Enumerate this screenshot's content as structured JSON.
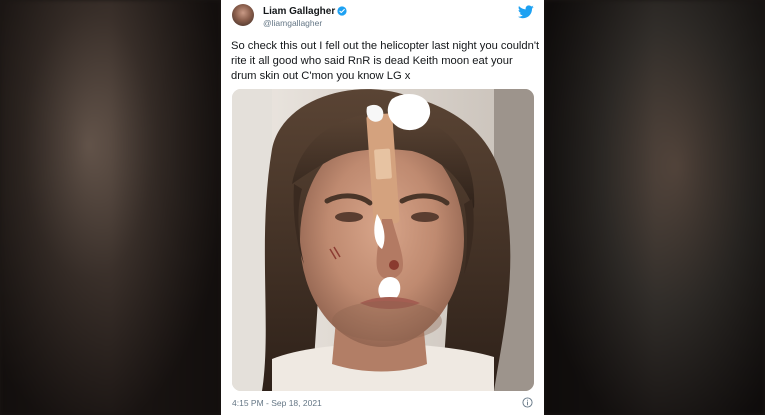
{
  "tweet": {
    "display_name": "Liam Gallagher",
    "handle": "@liamgallagher",
    "text": "So check this out I fell out the helicopter last night you couldn't rite it all good who said RnR is dead Keith moon eat your drum skin out C'mon you know LG x",
    "timestamp": "4:15 PM - Sep 18, 2021"
  },
  "icons": {
    "verified": "verified-badge-icon",
    "brand": "twitter-bird-icon",
    "info": "info-icon"
  },
  "colors": {
    "twitter_blue": "#1da1f2",
    "text": "#14171a",
    "secondary_text": "#657786"
  }
}
